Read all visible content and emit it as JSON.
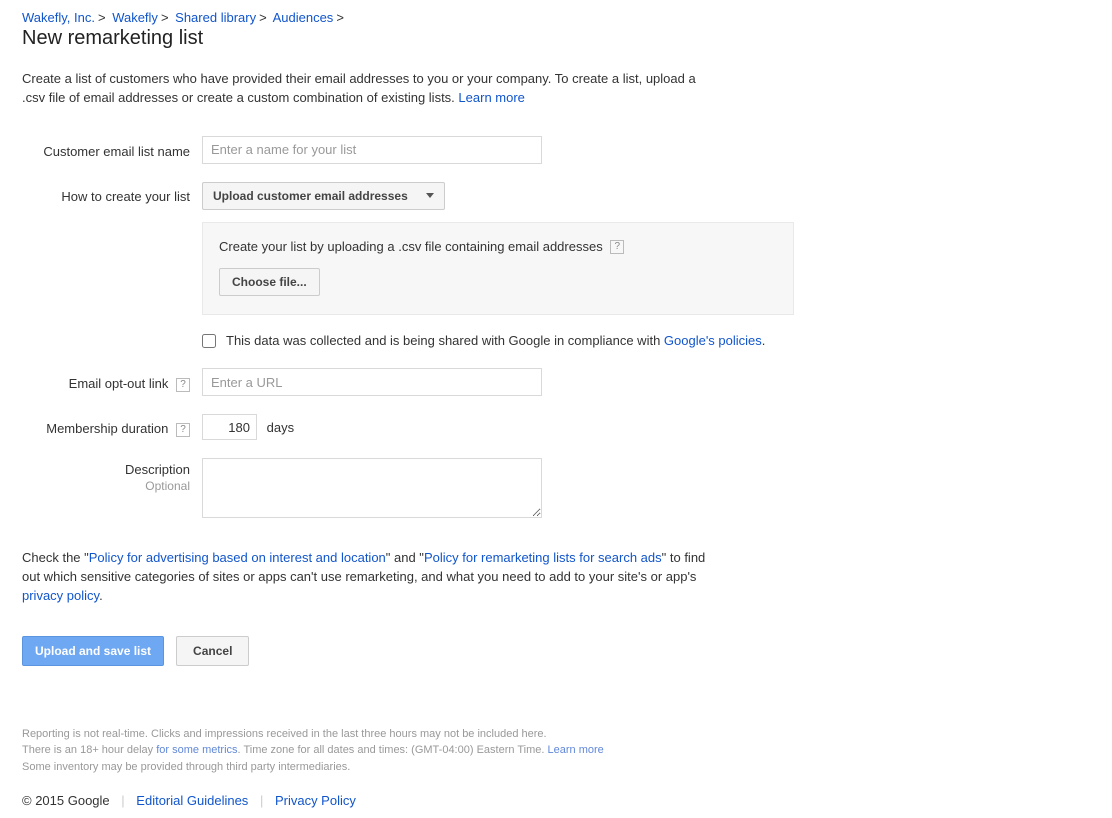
{
  "breadcrumb": {
    "items": [
      {
        "label": "Wakefly, Inc."
      },
      {
        "label": "Wakefly"
      },
      {
        "label": "Shared library"
      },
      {
        "label": "Audiences"
      }
    ]
  },
  "page_title": "New remarketing list",
  "intro": {
    "text_a": "Create a list of customers who have provided their email addresses to you or your company. To create a list, upload a .csv file of email addresses or create a custom combination of existing lists. ",
    "learn_more": "Learn more"
  },
  "form": {
    "name": {
      "label": "Customer email list name",
      "placeholder": "Enter a name for your list",
      "value": ""
    },
    "how": {
      "label": "How to create your list",
      "selected": "Upload customer email addresses"
    },
    "upload_panel": {
      "text": "Create your list by uploading a .csv file containing email addresses",
      "button": "Choose file..."
    },
    "consent": {
      "text": "This data was collected and is being shared with Google in compliance with ",
      "link": "Google's policies",
      "tail": "."
    },
    "optout": {
      "label": "Email opt-out link",
      "placeholder": "Enter a URL",
      "value": ""
    },
    "duration": {
      "label": "Membership duration",
      "value": "180",
      "unit": "days"
    },
    "description": {
      "label": "Description",
      "sublabel": "Optional",
      "value": ""
    }
  },
  "policy": {
    "pre": "Check the \"",
    "link1": "Policy for advertising based on interest and location",
    "mid1": "\" and \"",
    "link2": "Policy for remarketing lists for search ads",
    "mid2": "\" to find out which sensitive categories of sites or apps can't use remarketing, and what you need to add to your site's or app's ",
    "link3": "privacy policy",
    "tail": "."
  },
  "actions": {
    "primary": "Upload and save list",
    "cancel": "Cancel"
  },
  "footer_note": {
    "line1": "Reporting is not real-time. Clicks and impressions received in the last three hours may not be included here.",
    "line2a": "There is an 18+ hour delay ",
    "line2link": "for some metrics",
    "line2b": ". Time zone for all dates and times: (GMT-04:00) Eastern Time. ",
    "line2learn": "Learn more",
    "line3": "Some inventory may be provided through third party intermediaries."
  },
  "footer_links": {
    "copyright": "© 2015 Google",
    "editorial": "Editorial Guidelines",
    "privacy": "Privacy Policy"
  }
}
